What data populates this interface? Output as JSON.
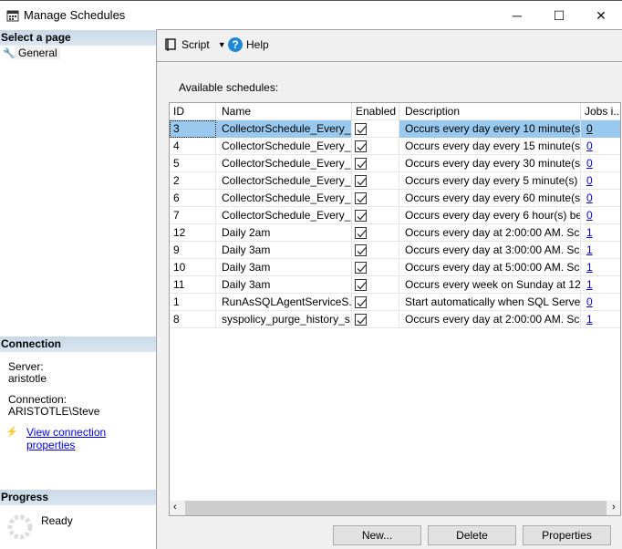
{
  "window": {
    "title": "Manage Schedules",
    "minimize": "─",
    "maximize": "☐",
    "close": "✕"
  },
  "left": {
    "select_header": "Select a page",
    "pages": [
      {
        "label": "General",
        "icon": "wrench-icon"
      }
    ],
    "connection_header": "Connection",
    "server_label": "Server:",
    "server_value": "aristotle",
    "connection_label": "Connection:",
    "connection_value": "ARISTOTLE\\Steve",
    "view_props": "View connection properties",
    "progress_header": "Progress",
    "progress_status": "Ready"
  },
  "toolbar": {
    "script": "Script",
    "help": "Help"
  },
  "main": {
    "label": "Available schedules:",
    "columns": [
      "ID",
      "Name",
      "Enabled",
      "Description",
      "Jobs i..."
    ],
    "rows": [
      {
        "id": "3",
        "name": "CollectorSchedule_Every_...",
        "enabled": true,
        "desc": "Occurs every day every 10 minute(s) ...",
        "jobs": "0"
      },
      {
        "id": "4",
        "name": "CollectorSchedule_Every_...",
        "enabled": true,
        "desc": "Occurs every day every 15 minute(s) ...",
        "jobs": "0"
      },
      {
        "id": "5",
        "name": "CollectorSchedule_Every_...",
        "enabled": true,
        "desc": "Occurs every day every 30 minute(s) ...",
        "jobs": "0"
      },
      {
        "id": "2",
        "name": "CollectorSchedule_Every_...",
        "enabled": true,
        "desc": "Occurs every day every 5 minute(s) b...",
        "jobs": "0"
      },
      {
        "id": "6",
        "name": "CollectorSchedule_Every_...",
        "enabled": true,
        "desc": "Occurs every day every 60 minute(s) ...",
        "jobs": "0"
      },
      {
        "id": "7",
        "name": "CollectorSchedule_Every_...",
        "enabled": true,
        "desc": "Occurs every day every 6 hour(s) bet...",
        "jobs": "0"
      },
      {
        "id": "12",
        "name": "Daily 2am",
        "enabled": true,
        "desc": "Occurs every day at 2:00:00 AM. Sc...",
        "jobs": "1"
      },
      {
        "id": "9",
        "name": "Daily 3am",
        "enabled": true,
        "desc": "Occurs every day at 3:00:00 AM. Sc...",
        "jobs": "1"
      },
      {
        "id": "10",
        "name": "Daily 3am",
        "enabled": true,
        "desc": "Occurs every day at 5:00:00 AM. Sc...",
        "jobs": "1"
      },
      {
        "id": "11",
        "name": "Daily 3am",
        "enabled": true,
        "desc": "Occurs every week on Sunday at 12...",
        "jobs": "1"
      },
      {
        "id": "1",
        "name": "RunAsSQLAgentServiceS...",
        "enabled": true,
        "desc": "Start automatically when SQL Server...",
        "jobs": "0"
      },
      {
        "id": "8",
        "name": "syspolicy_purge_history_s...",
        "enabled": true,
        "desc": "Occurs every day at 2:00:00 AM. Sc...",
        "jobs": "1"
      }
    ],
    "selected_index": 0
  },
  "buttons": {
    "new": "New...",
    "delete": "Delete",
    "properties": "Properties"
  }
}
